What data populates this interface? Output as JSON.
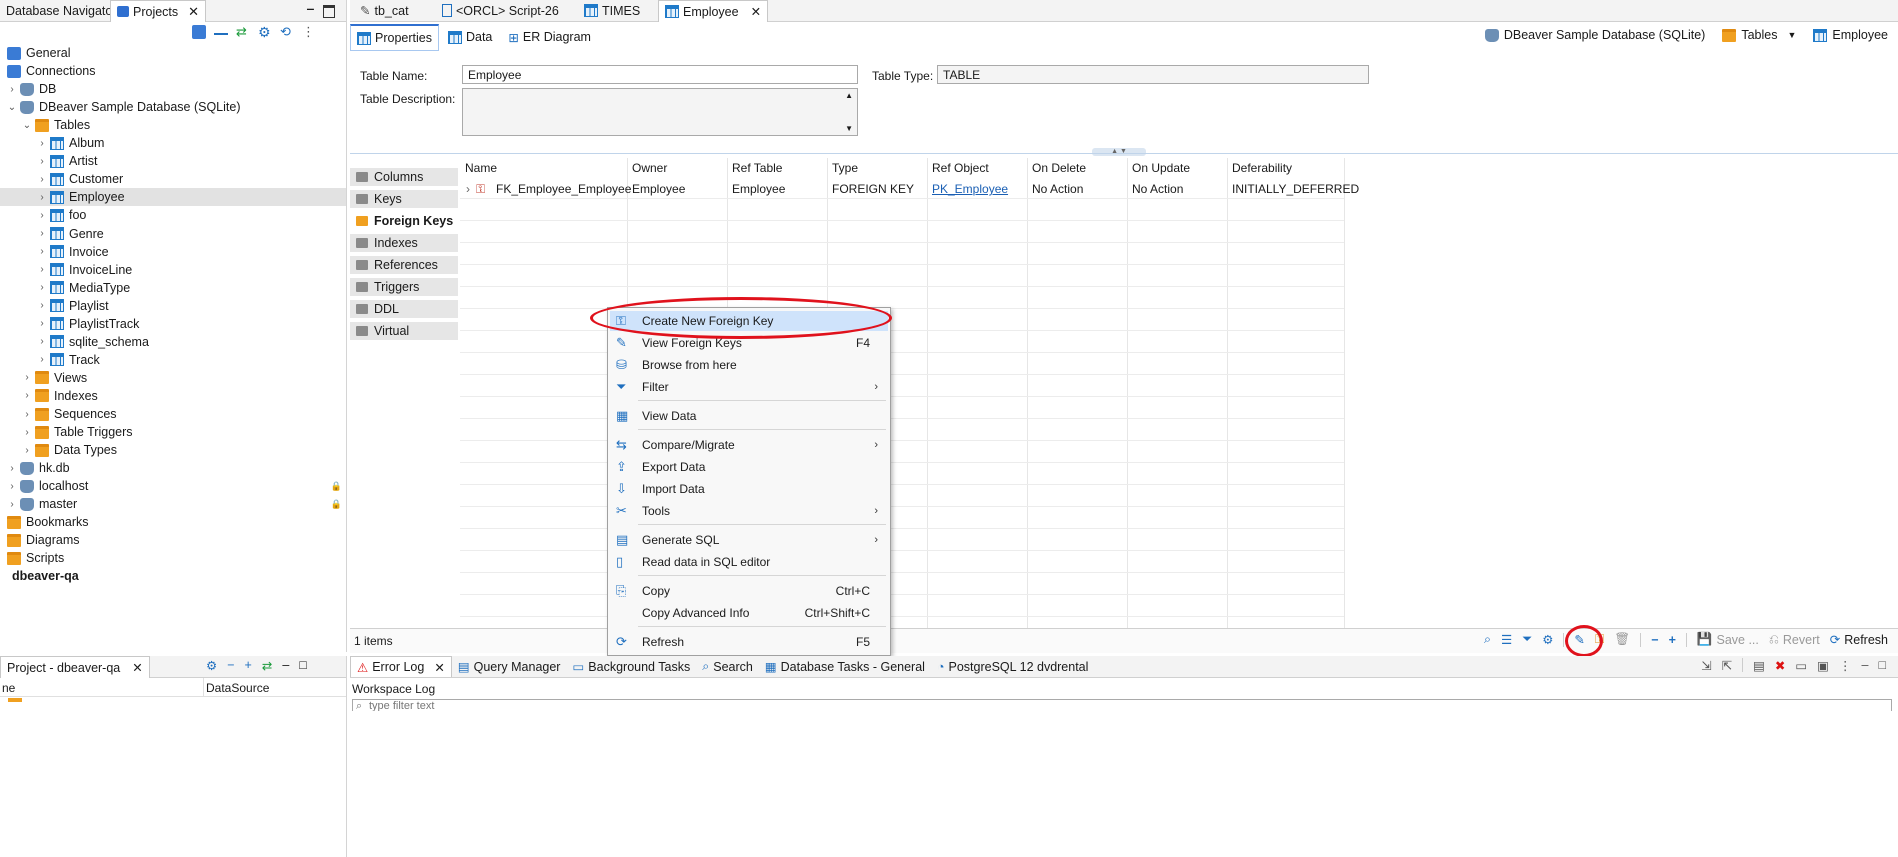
{
  "nav": {
    "tabs": [
      {
        "label": "Database Navigator"
      },
      {
        "label": "Projects"
      }
    ],
    "tree": [
      {
        "label": "General",
        "depth": 0,
        "icon": "project-icon"
      },
      {
        "label": "Connections",
        "depth": 0,
        "icon": "connections-icon"
      },
      {
        "label": "DB",
        "depth": 1,
        "icon": "database-icon"
      },
      {
        "label": "DBeaver Sample Database (SQLite)",
        "depth": 1,
        "icon": "sqlite-icon"
      },
      {
        "label": "Tables",
        "depth": 2,
        "icon": "folder-icon"
      },
      {
        "label": "Album",
        "depth": 3,
        "icon": "table-icon"
      },
      {
        "label": "Artist",
        "depth": 3,
        "icon": "table-icon"
      },
      {
        "label": "Customer",
        "depth": 3,
        "icon": "table-icon"
      },
      {
        "label": "Employee",
        "depth": 3,
        "icon": "table-icon",
        "selected": true
      },
      {
        "label": "foo",
        "depth": 3,
        "icon": "table-icon"
      },
      {
        "label": "Genre",
        "depth": 3,
        "icon": "table-icon"
      },
      {
        "label": "Invoice",
        "depth": 3,
        "icon": "table-icon"
      },
      {
        "label": "InvoiceLine",
        "depth": 3,
        "icon": "table-icon"
      },
      {
        "label": "MediaType",
        "depth": 3,
        "icon": "table-icon"
      },
      {
        "label": "Playlist",
        "depth": 3,
        "icon": "table-icon"
      },
      {
        "label": "PlaylistTrack",
        "depth": 3,
        "icon": "table-icon"
      },
      {
        "label": "sqlite_schema",
        "depth": 3,
        "icon": "table-icon"
      },
      {
        "label": "Track",
        "depth": 3,
        "icon": "table-icon"
      },
      {
        "label": "Views",
        "depth": 2,
        "icon": "folder-icon"
      },
      {
        "label": "Indexes",
        "depth": 2,
        "icon": "folder-icon"
      },
      {
        "label": "Sequences",
        "depth": 2,
        "icon": "folder-icon"
      },
      {
        "label": "Table Triggers",
        "depth": 2,
        "icon": "folder-icon"
      },
      {
        "label": "Data Types",
        "depth": 2,
        "icon": "folder-icon"
      },
      {
        "label": "hk.db",
        "depth": 1,
        "icon": "database-icon"
      },
      {
        "label": "localhost",
        "depth": 1,
        "icon": "server-icon"
      },
      {
        "label": "master",
        "depth": 1,
        "icon": "server-icon"
      },
      {
        "label": "Bookmarks",
        "depth": 0,
        "icon": "folder-icon"
      },
      {
        "label": "Diagrams",
        "depth": 0,
        "icon": "folder-icon"
      },
      {
        "label": "Scripts",
        "depth": 0,
        "icon": "folder-icon"
      },
      {
        "label": "dbeaver-qa",
        "depth": -1,
        "icon": "none",
        "bold": true
      }
    ]
  },
  "editor": {
    "tabs": [
      {
        "label": "tb_cat"
      },
      {
        "label": "<ORCL> Script-26"
      },
      {
        "label": "TIMES"
      },
      {
        "label": "Employee"
      }
    ],
    "subtabs": [
      {
        "label": "Properties"
      },
      {
        "label": "Data"
      },
      {
        "label": "ER Diagram"
      }
    ],
    "breadcrumb": {
      "datasource": "DBeaver Sample Database (SQLite)",
      "folder": "Tables",
      "table": "Employee"
    },
    "table_name_label": "Table Name:",
    "table_name_value": "Employee",
    "table_type_label": "Table Type:",
    "table_type_value": "TABLE",
    "table_desc_label": "Table Description:",
    "sections": [
      {
        "label": "Columns"
      },
      {
        "label": "Keys"
      },
      {
        "label": "Foreign Keys",
        "active": true
      },
      {
        "label": "Indexes"
      },
      {
        "label": "References"
      },
      {
        "label": "Triggers"
      },
      {
        "label": "DDL"
      },
      {
        "label": "Virtual"
      }
    ],
    "grid": {
      "headers": [
        "Name",
        "Owner",
        "Ref Table",
        "Type",
        "Ref Object",
        "On Delete",
        "On Update",
        "Deferability"
      ],
      "row": [
        "FK_Employee_Employee",
        "Employee",
        "Employee",
        "FOREIGN KEY",
        "PK_Employee",
        "No Action",
        "No Action",
        "INITIALLY_DEFERRED"
      ]
    },
    "status_count": "1 items",
    "toolbar": {
      "save_label": "Save ...",
      "revert_label": "Revert",
      "refresh_label": "Refresh"
    }
  },
  "context_menu": {
    "items": [
      {
        "label": "Create New Foreign Key",
        "key": "",
        "submenu": false,
        "highlight": true,
        "icon": "create-fk-icon"
      },
      {
        "label": "View Foreign Keys",
        "key": "F4",
        "submenu": false,
        "icon": "edit-pencil-icon"
      },
      {
        "label": "Browse from here",
        "key": "",
        "submenu": false,
        "icon": "browse-db-icon"
      },
      {
        "label": "Filter",
        "key": "",
        "submenu": true,
        "icon": "filter-icon"
      },
      {
        "label": "View Data",
        "key": "",
        "submenu": false,
        "icon": "view-data-icon",
        "sep_before": true
      },
      {
        "label": "Compare/Migrate",
        "key": "",
        "submenu": true,
        "icon": "compare-icon",
        "sep_before": true
      },
      {
        "label": "Export Data",
        "key": "",
        "submenu": false,
        "icon": "export-icon"
      },
      {
        "label": "Import Data",
        "key": "",
        "submenu": false,
        "icon": "import-icon"
      },
      {
        "label": "Tools",
        "key": "",
        "submenu": true,
        "icon": "tools-icon"
      },
      {
        "label": "Generate SQL",
        "key": "",
        "submenu": true,
        "icon": "generate-sql-icon",
        "sep_before": true
      },
      {
        "label": "Read data in SQL editor",
        "key": "",
        "submenu": false,
        "icon": "sql-editor-icon"
      },
      {
        "label": "Copy",
        "key": "Ctrl+C",
        "submenu": false,
        "icon": "copy-icon",
        "sep_before": true
      },
      {
        "label": "Copy Advanced Info",
        "key": "Ctrl+Shift+C",
        "submenu": false,
        "icon": "none"
      },
      {
        "label": "Refresh",
        "key": "F5",
        "submenu": false,
        "icon": "refresh-icon",
        "sep_before": true
      }
    ]
  },
  "bottom_left": {
    "tab": "Project - dbeaver-qa",
    "col1": "ne",
    "col2": "DataSource"
  },
  "bottom_right": {
    "tabs": [
      {
        "label": "Error Log"
      },
      {
        "label": "Query Manager"
      },
      {
        "label": "Background Tasks"
      },
      {
        "label": "Search"
      },
      {
        "label": "Database Tasks - General"
      },
      {
        "label": "PostgreSQL 12 dvdrental"
      }
    ],
    "workspace_log": "Workspace Log",
    "filter_placeholder": "type filter text"
  },
  "colors": {
    "accent": "#2f6fd0",
    "highlight_ring": "#e0121c",
    "folder": "#f0a020"
  }
}
